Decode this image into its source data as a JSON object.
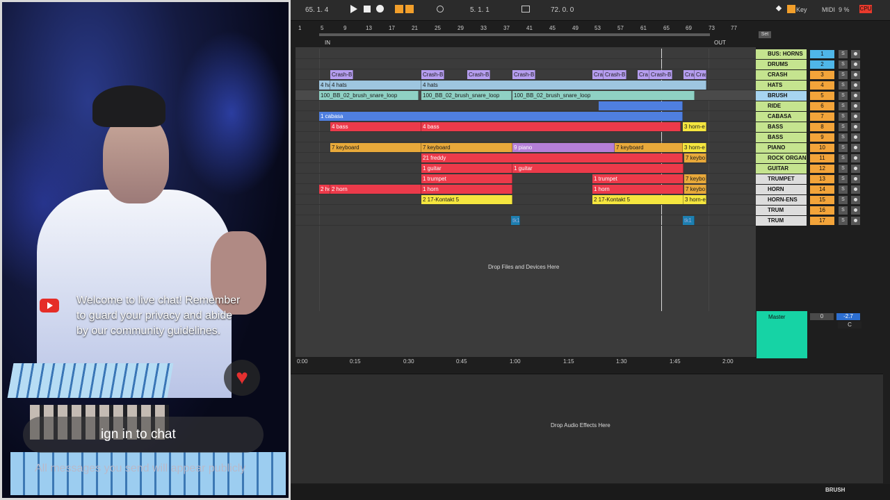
{
  "webcam": {
    "welcome_text": "Welcome to live chat! Remember to guard your privacy and abide by our community guidelines.",
    "heart_icon": "heart-icon",
    "signin_text": "ign in to chat",
    "public_notice": "All messages you send will appear publicly"
  },
  "transport": {
    "position": "65.  1.  4",
    "loop_start": "5.  1.  1",
    "loop_length": "72.  0.  0",
    "key_label": "Key",
    "midi_label": "MIDI",
    "cpu_percent": "9 %",
    "cpu_label": "CPU"
  },
  "ruler": {
    "bars": [
      "1",
      "5",
      "9",
      "13",
      "17",
      "21",
      "25",
      "29",
      "33",
      "37",
      "41",
      "45",
      "49",
      "53",
      "57",
      "61",
      "65",
      "69",
      "73",
      "77"
    ],
    "in_label": "IN",
    "out_label": "OUT",
    "set_label": "Set"
  },
  "time_ruler": [
    "0:00",
    "0:15",
    "0:30",
    "0:45",
    "1:00",
    "1:15",
    "1:30",
    "1:45",
    "2:00"
  ],
  "tracks": [
    {
      "name": "BUS: HORNS",
      "num": "1",
      "color": "#c5e48f"
    },
    {
      "name": "DRUMS",
      "num": "2",
      "color": "#c5e48f"
    },
    {
      "name": "CRASH",
      "num": "3",
      "color": "#c5e48f"
    },
    {
      "name": "HATS",
      "num": "4",
      "color": "#c5e48f"
    },
    {
      "name": "BRUSH",
      "num": "5",
      "color": "#a7d4f0"
    },
    {
      "name": "RIDE",
      "num": "6",
      "color": "#c5e48f"
    },
    {
      "name": "CABASA",
      "num": "7",
      "color": "#c5e48f"
    },
    {
      "name": "BASS",
      "num": "8",
      "color": "#c5e48f"
    },
    {
      "name": "BASS",
      "num": "9",
      "color": "#c5e48f"
    },
    {
      "name": "PIANO",
      "num": "10",
      "color": "#c5e48f"
    },
    {
      "name": "ROCK ORGAN",
      "num": "11",
      "color": "#c5e48f"
    },
    {
      "name": "GUITAR",
      "num": "12",
      "color": "#c5e48f"
    },
    {
      "name": "TRUMPET",
      "num": "13",
      "color": "#dddddd"
    },
    {
      "name": "HORN",
      "num": "14",
      "color": "#dddddd"
    },
    {
      "name": "HORN-ENS",
      "num": "15",
      "color": "#dddddd"
    },
    {
      "name": "TRUM",
      "num": "16",
      "color": "#dddddd"
    },
    {
      "name": "TRUM",
      "num": "17",
      "color": "#dddddd"
    }
  ],
  "clips": {
    "crash": [
      "Crash-B",
      "Crash-B",
      "Crash-B",
      "Crash-B",
      "Cra",
      "Crash-B",
      "Cra",
      "Crash-B",
      "Cra",
      "Crash"
    ],
    "hats": [
      "4 ha",
      "4 hats",
      "4 hats"
    ],
    "brush": [
      "100_BB_02_brush_snare_loop",
      "100_BB_02_brush_snare_loop",
      "100_BB_02_brush_snare_loop"
    ],
    "cabasa": "1 cabasa",
    "bass": [
      "4 bass",
      "4 bass",
      "3 horn-e"
    ],
    "piano": [
      "7 keyboard",
      "7 keyboard",
      "9 piano",
      "7 keyboard",
      "3 horn-e"
    ],
    "organ": [
      "21 freddy",
      "7 keybo"
    ],
    "guitar": [
      "1 guitar",
      "1 guitar"
    ],
    "trumpet": [
      "1 trumpet",
      "1 trumpet",
      "7 keybo"
    ],
    "horn": [
      "2 ho",
      "2 horn",
      "1 horn",
      "1 horn",
      "7 keybo"
    ],
    "horn_ens": [
      "2 17-Kontakt 5",
      "2 17-Kontakt 5",
      "3 horn-e"
    ],
    "trum": [
      "tk1",
      "tk1"
    ]
  },
  "drop_files": "Drop Files and Devices Here",
  "master": {
    "name": "Master",
    "vol": "0",
    "peak": "-2.7",
    "pan": "C"
  },
  "drop_fx": "Drop Audio Effects Here",
  "status_track": "BRUSH",
  "colors": {
    "crash": "#b69ef0",
    "hats": "#9ec6e0",
    "brush": "#8fd1c4",
    "ride": "#4f7fe0",
    "red": "#ec3a4a",
    "orange": "#e8a93a",
    "violet": "#b57fd7",
    "yellow": "#f5e63f",
    "master": "#16d3a5",
    "track_num": "#f3a43a"
  }
}
